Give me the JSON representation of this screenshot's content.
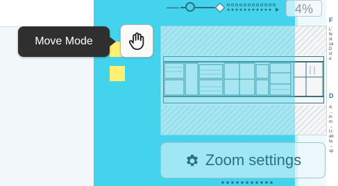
{
  "tooltip": {
    "label": "Move Mode"
  },
  "move_mode_button": {
    "icon": "hand-icon"
  },
  "zoom": {
    "value_label": "4%"
  },
  "zoom_settings": {
    "label": "Zoom settings",
    "icon": "gear-icon"
  },
  "doc_pane": {
    "heading_1": "F",
    "lines_1": [
      "L'",
      "fe",
      "st",
      "va",
      "D",
      "st",
      "a"
    ],
    "heading_2": "D",
    "lines_2": [
      "A:",
      "→",
      "in",
      "m",
      "→",
      "U:",
      "ab",
      "ta",
      "→",
      "sp"
    ]
  },
  "colors": {
    "canvas": "#44d3ec",
    "tooltip_bg": "#2f2f2f",
    "swatch": "#ffef73",
    "accent": "#2f6f80"
  }
}
